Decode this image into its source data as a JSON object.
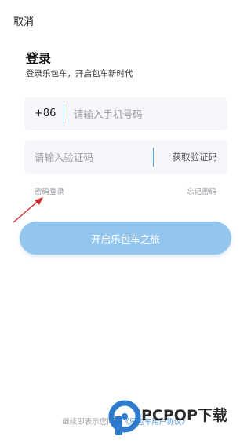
{
  "header": {
    "cancel_label": "取消"
  },
  "login": {
    "title": "登录",
    "subtitle": "登录乐包车，开启包车新时代"
  },
  "phone": {
    "country_code": "+86",
    "placeholder": "请输入手机号码",
    "value": ""
  },
  "code": {
    "placeholder": "请输入验证码",
    "value": "",
    "get_code_label": "获取验证码"
  },
  "links": {
    "password_login": "密码登录",
    "forgot_password": "忘记密码"
  },
  "submit": {
    "label": "开启乐包车之旅"
  },
  "agreement": {
    "prefix": "继续即表示您同意",
    "link": "《乐包车用户协议》"
  },
  "watermark": {
    "text": "PCPOP下载"
  },
  "colors": {
    "accent": "#56a8e6",
    "button": "#93c6ee",
    "field_bg": "#f5f6fa",
    "link": "#4a8fd6",
    "arrow": "#d22b2b"
  }
}
